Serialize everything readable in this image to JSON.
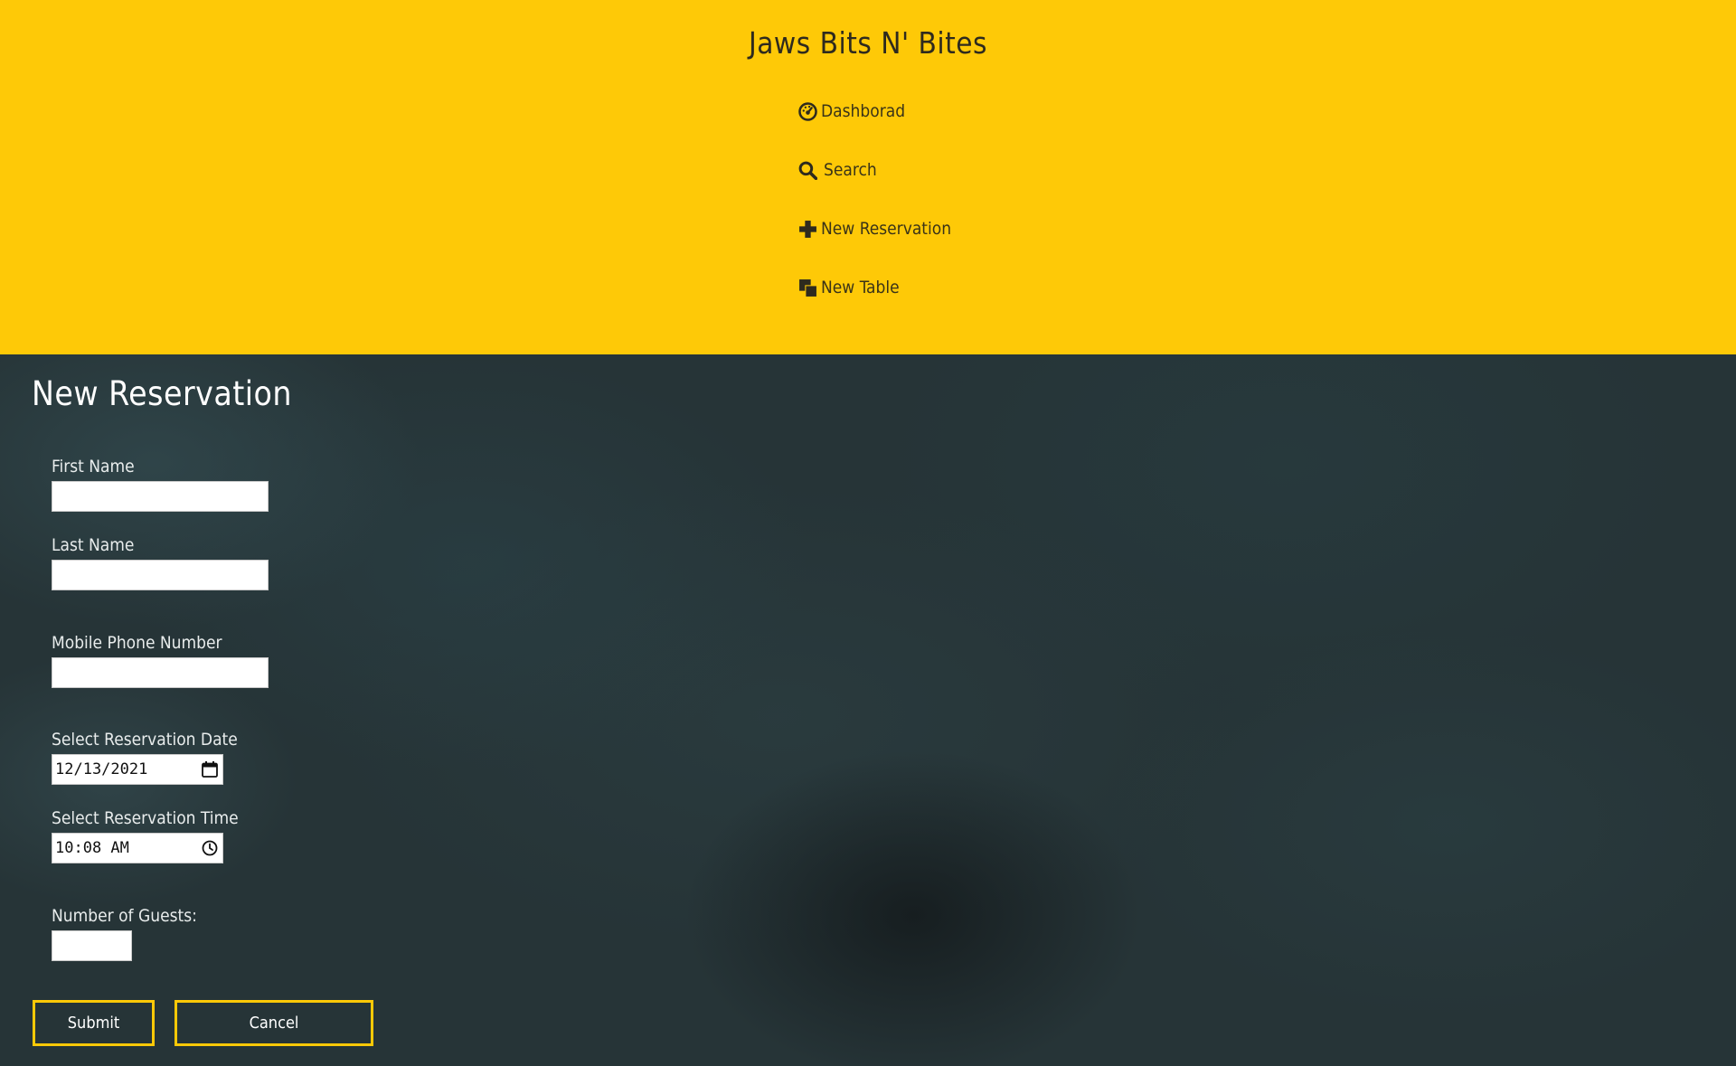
{
  "header": {
    "brand": "Jaws Bits N' Bites",
    "background_color": "#fec907",
    "nav": [
      {
        "label": "Dashborad",
        "icon": "dashboard-icon"
      },
      {
        "label": "Search",
        "icon": "search-icon"
      },
      {
        "label": "New Reservation",
        "icon": "plus-icon"
      },
      {
        "label": "New Table",
        "icon": "table-icon"
      }
    ]
  },
  "form": {
    "title": "New Reservation",
    "first_name": {
      "label": "First Name",
      "value": ""
    },
    "last_name": {
      "label": "Last Name",
      "value": ""
    },
    "mobile": {
      "label": "Mobile Phone Number",
      "value": ""
    },
    "date": {
      "label": "Select Reservation Date",
      "value": "12/13/2021",
      "icon": "calendar-icon"
    },
    "time": {
      "label": "Select Reservation Time",
      "value": "10:08 AM",
      "icon": "clock-icon"
    },
    "guests": {
      "label": "Number of Guests:",
      "value": ""
    },
    "submit_label": "Submit",
    "cancel_label": "Cancel",
    "button_border_color": "#fec907"
  }
}
